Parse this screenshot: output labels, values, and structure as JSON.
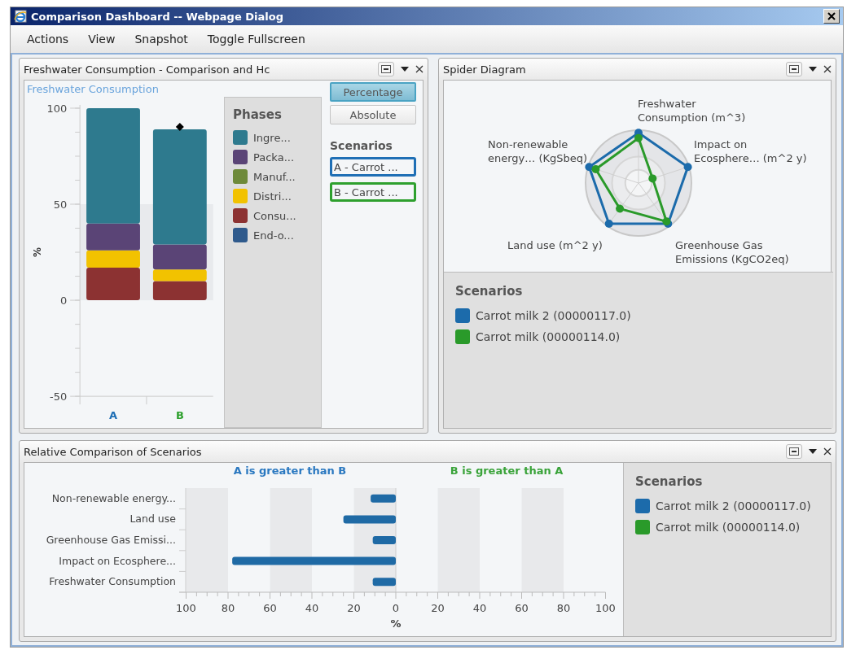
{
  "window": {
    "title": "Comparison Dashboard -- Webpage Dialog"
  },
  "menu": [
    "Actions",
    "View",
    "Snapshot",
    "Toggle Fullscreen"
  ],
  "freshwater_panel": {
    "title": "Freshwater Consumption - Comparison and Hc",
    "chart_title": "Freshwater Consumption",
    "chart_data": {
      "type": "bar",
      "stacked": true,
      "ylabel": "%",
      "categories": [
        "A",
        "B"
      ],
      "yticks": [
        -50,
        0,
        50,
        100
      ],
      "ylim": [
        -50,
        100
      ],
      "series": [
        {
          "name": "Ingre...",
          "color": "#2e7a8e",
          "values": [
            60,
            60
          ]
        },
        {
          "name": "Packa...",
          "color": "#5a4476",
          "values": [
            14,
            13
          ]
        },
        {
          "name": "Manuf...",
          "color": "#6e8a3a",
          "values": [
            0,
            0
          ]
        },
        {
          "name": "Distri...",
          "color": "#f2c200",
          "values": [
            9,
            6
          ]
        },
        {
          "name": "Consu...",
          "color": "#8c3232",
          "values": [
            17,
            10
          ]
        },
        {
          "name": "End-o...",
          "color": "#2f5a8c",
          "values": [
            0,
            0
          ]
        }
      ],
      "bands": [
        {
          "axis": "y",
          "from": 0,
          "to": 50
        }
      ]
    },
    "legend_title": "Phases",
    "modes": [
      {
        "label": "Percentage",
        "selected": true
      },
      {
        "label": "Absolute",
        "selected": false
      }
    ],
    "scenarios_title": "Scenarios",
    "scenarios": [
      {
        "label": "A - Carrot ...",
        "color": "#1f6fb5",
        "total_marker": false
      },
      {
        "label": "B - Carrot ...",
        "color": "#2ea02e",
        "total_marker": true
      }
    ]
  },
  "spider_panel": {
    "title": "Spider Diagram",
    "axes": [
      {
        "lines": [
          "Freshwater",
          "Consumption (m^3)"
        ]
      },
      {
        "lines": [
          "Non-renewable",
          "energy… (KgSbeq)"
        ]
      },
      {
        "lines": [
          "Impact on",
          "Ecosphere… (m^2 y)"
        ]
      },
      {
        "lines": [
          "Land use (m^2 y)"
        ]
      },
      {
        "lines": [
          "Greenhouse Gas",
          "Emissions (KgCO2eq)"
        ]
      }
    ],
    "legend": {
      "title": "Scenarios",
      "items": [
        {
          "label": "Carrot milk 2 (00000117.0)",
          "color": "#1c6bab"
        },
        {
          "label": "Carrot milk (00000114.0)",
          "color": "#2a9a2a"
        }
      ]
    }
  },
  "relative_panel": {
    "title": "Relative Comparison of Scenarios",
    "captions": [
      {
        "text": "A is greater than B",
        "color": "#2a78c0"
      },
      {
        "text": "B is greater than A",
        "color": "#3aa33a"
      }
    ],
    "chart_data": {
      "type": "bar",
      "orientation": "horizontal",
      "xlabel": "%",
      "categories": [
        "Non-renewable energy...",
        "Land use",
        "Greenhouse Gas Emissi...",
        "Impact on Ecosphere...",
        "Freshwater Consumption"
      ],
      "series": [
        {
          "color": "#1f6aa5",
          "values": [
            -12,
            -25,
            -11,
            -78,
            -11
          ]
        }
      ],
      "xlim": [
        -100,
        100
      ],
      "xticks": [
        {
          "value": -100,
          "label": "100"
        },
        {
          "value": -80,
          "label": "80"
        },
        {
          "value": -60,
          "label": "60"
        },
        {
          "value": -40,
          "label": "40"
        },
        {
          "value": -20,
          "label": "20"
        },
        {
          "value": 0,
          "label": "0"
        },
        {
          "value": 20,
          "label": "20"
        },
        {
          "value": 40,
          "label": "40"
        },
        {
          "value": 60,
          "label": "60"
        },
        {
          "value": 80,
          "label": "80"
        },
        {
          "value": 100,
          "label": "100"
        }
      ]
    },
    "legend": {
      "title": "Scenarios",
      "items": [
        {
          "label": "Carrot milk 2 (00000117.0)",
          "color": "#1c6bab"
        },
        {
          "label": "Carrot milk (00000114.0)",
          "color": "#2a9a2a"
        }
      ]
    }
  }
}
